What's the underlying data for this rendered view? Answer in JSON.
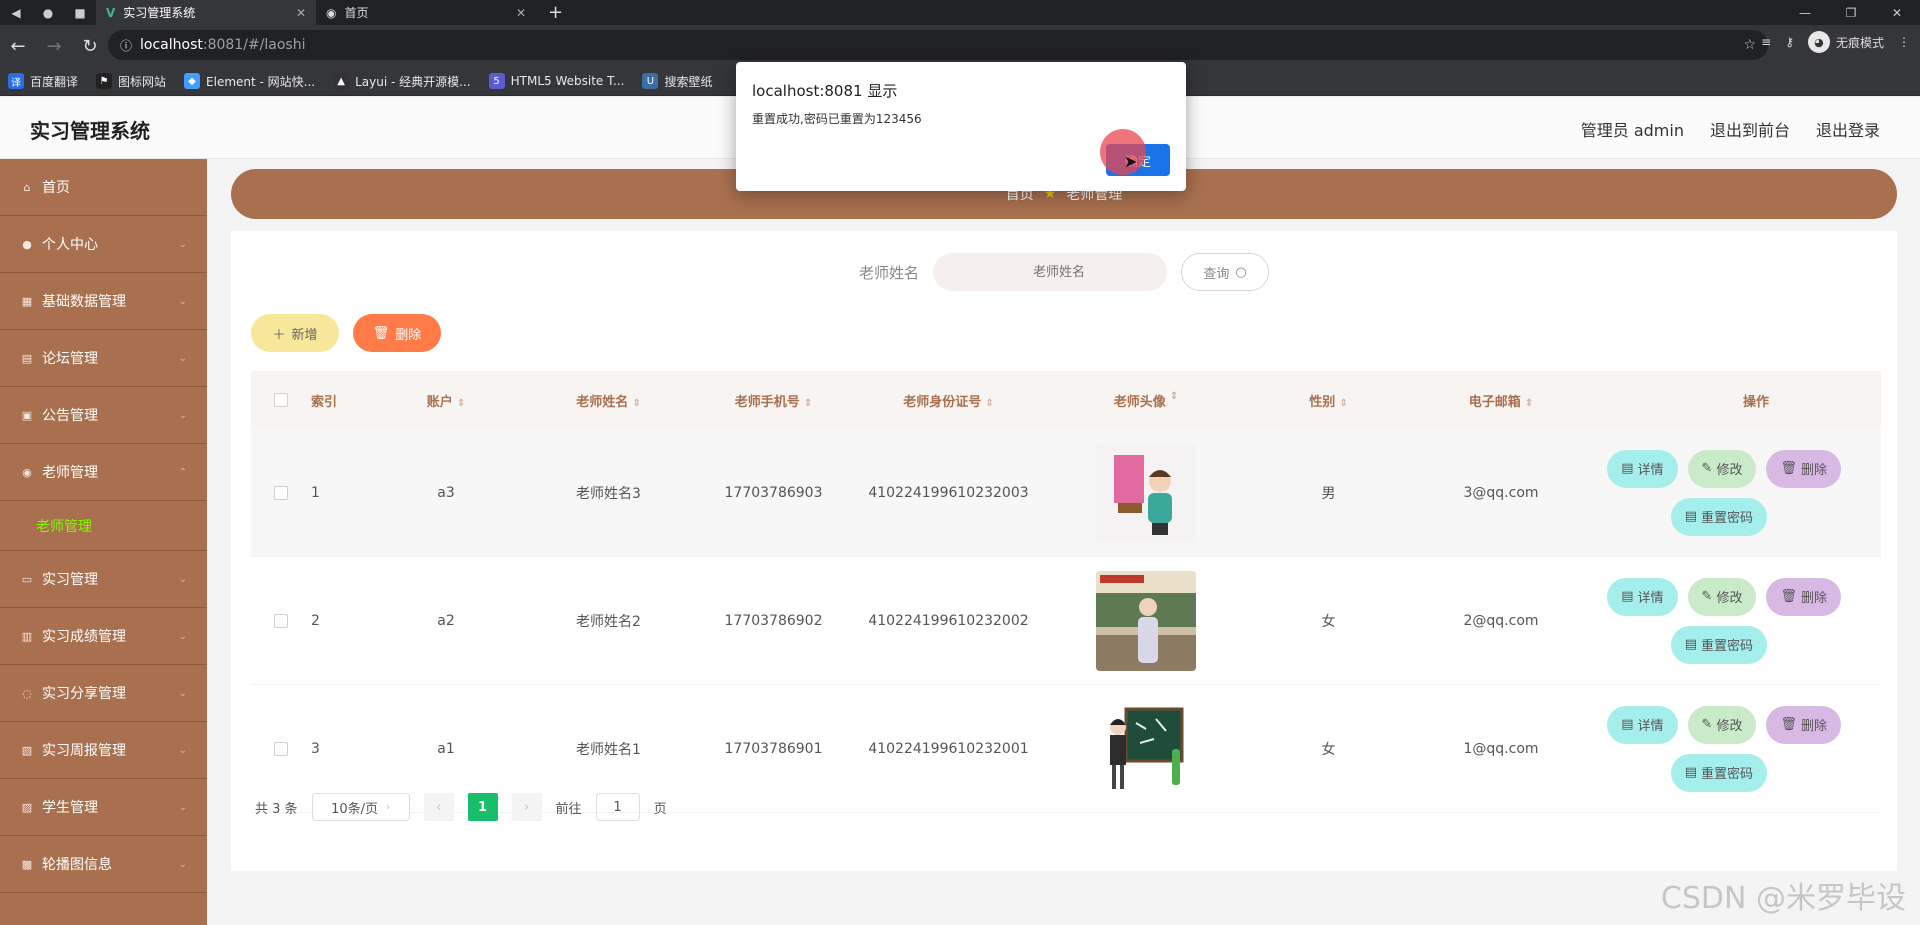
{
  "browser": {
    "tabs": [
      {
        "title": "实习管理系统",
        "active": true
      },
      {
        "title": "首页",
        "active": false
      }
    ],
    "url_host": "localhost",
    "url_path": ":8081/#/laoshi",
    "incognito_label": "无痕模式",
    "bookmarks": [
      {
        "label": "百度翻译",
        "color": "#2b6de5"
      },
      {
        "label": "图标网站",
        "color": "#222222"
      },
      {
        "label": "Element - 网站快...",
        "color": "#409eff"
      },
      {
        "label": "Layui - 经典开源模...",
        "color": "#333333"
      },
      {
        "label": "HTML5 Website T...",
        "color": "#5b5bd6"
      },
      {
        "label": "搜索壁纸",
        "color": "#3a6ea5"
      }
    ]
  },
  "header": {
    "title": "实习管理系统",
    "admin": "管理员 admin",
    "to_front": "退出到前台",
    "logout": "退出登录"
  },
  "sidebar": {
    "items": [
      {
        "label": "首页",
        "icon": "home-icon"
      },
      {
        "label": "个人中心",
        "icon": "user-icon"
      },
      {
        "label": "基础数据管理",
        "icon": "data-icon"
      },
      {
        "label": "论坛管理",
        "icon": "forum-icon"
      },
      {
        "label": "公告管理",
        "icon": "notice-icon"
      },
      {
        "label": "老师管理",
        "icon": "teacher-icon"
      }
    ],
    "active_sub": "老师管理",
    "items_after": [
      {
        "label": "实习管理",
        "icon": "intern-icon"
      },
      {
        "label": "实习成绩管理",
        "icon": "score-icon"
      },
      {
        "label": "实习分享管理",
        "icon": "share-icon"
      },
      {
        "label": "实习周报管理",
        "icon": "report-icon"
      },
      {
        "label": "学生管理",
        "icon": "student-icon"
      },
      {
        "label": "轮播图信息",
        "icon": "carousel-icon"
      }
    ]
  },
  "breadcrumb": {
    "home": "首页",
    "current": "老师管理"
  },
  "search": {
    "label": "老师姓名",
    "placeholder": "老师姓名",
    "button": "查询"
  },
  "actions": {
    "add": "新增",
    "delete": "删除"
  },
  "table": {
    "headers": {
      "index": "索引",
      "account": "账户",
      "name": "老师姓名",
      "phone": "老师手机号",
      "idcard": "老师身份证号",
      "avatar": "老师头像",
      "sex": "性别",
      "email": "电子邮箱",
      "ops": "操作"
    },
    "rows": [
      {
        "index": "1",
        "account": "a3",
        "name": "老师姓名3",
        "phone": "17703786903",
        "idcard": "410224199610232003",
        "sex": "男",
        "email": "3@qq.com"
      },
      {
        "index": "2",
        "account": "a2",
        "name": "老师姓名2",
        "phone": "17703786902",
        "idcard": "410224199610232002",
        "sex": "女",
        "email": "2@qq.com"
      },
      {
        "index": "3",
        "account": "a1",
        "name": "老师姓名1",
        "phone": "17703786901",
        "idcard": "410224199610232001",
        "sex": "女",
        "email": "1@qq.com"
      }
    ],
    "op_labels": {
      "detail": "详情",
      "edit": "修改",
      "delete": "删除",
      "reset": "重置密码"
    }
  },
  "pagination": {
    "total": "共 3 条",
    "page_size": "10条/页",
    "current": "1",
    "goto": "前往",
    "goto_value": "1",
    "page_unit": "页"
  },
  "dialog": {
    "title": "localhost:8081 显示",
    "message": "重置成功,密码已重置为123456",
    "ok": "确定"
  },
  "watermark": "CSDN @米罗毕设"
}
